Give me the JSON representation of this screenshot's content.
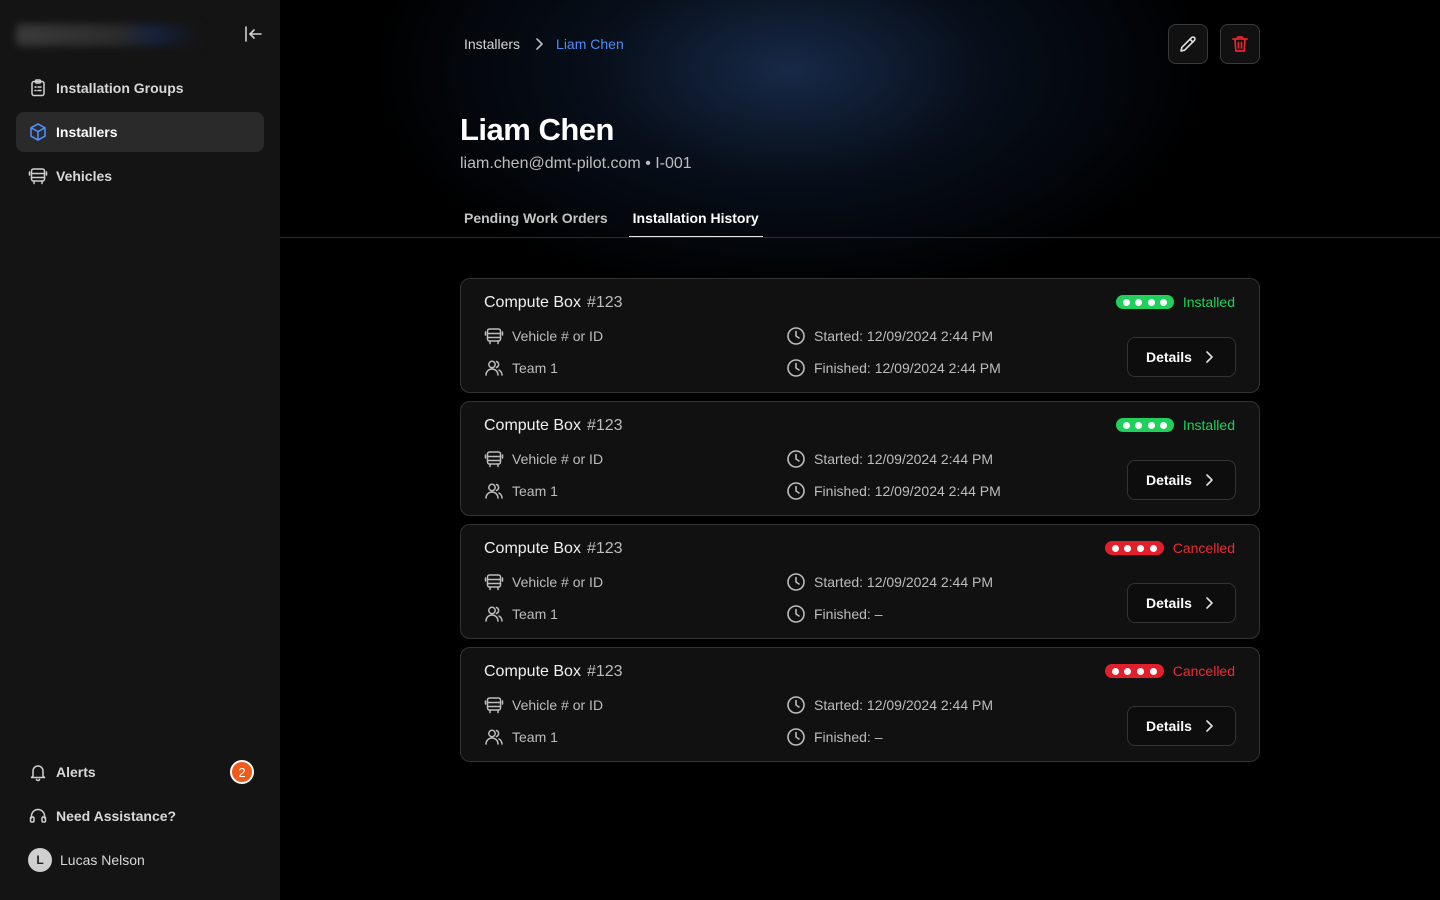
{
  "sidebar": {
    "nav": [
      {
        "label": "Installation Groups",
        "icon": "clipboard-list-icon",
        "active": false
      },
      {
        "label": "Installers",
        "icon": "box-icon",
        "active": true
      },
      {
        "label": "Vehicles",
        "icon": "bus-icon",
        "active": false
      }
    ],
    "alerts": {
      "label": "Alerts",
      "count": "2"
    },
    "help": {
      "label": "Need Assistance?"
    },
    "user": {
      "initial": "L",
      "name": "Lucas Nelson"
    }
  },
  "breadcrumb": {
    "parent": "Installers",
    "current": "Liam Chen"
  },
  "profile": {
    "name": "Liam Chen",
    "meta": "liam.chen@dmt-pilot.com • I-001"
  },
  "tabs": [
    {
      "label": "Pending Work Orders",
      "active": false
    },
    {
      "label": "Installation History",
      "active": true
    }
  ],
  "history": [
    {
      "title": "Compute Box",
      "number": "#123",
      "vehicle": "Vehicle # or ID",
      "team": "Team 1",
      "started": "Started: 12/09/2024 2:44 PM",
      "finished": "Finished: 12/09/2024 2:44 PM",
      "status": "Installed",
      "details": "Details"
    },
    {
      "title": "Compute Box",
      "number": "#123",
      "vehicle": "Vehicle # or ID",
      "team": "Team 1",
      "started": "Started: 12/09/2024 2:44 PM",
      "finished": "Finished: 12/09/2024 2:44 PM",
      "status": "Installed",
      "details": "Details"
    },
    {
      "title": "Compute Box",
      "number": "#123",
      "vehicle": "Vehicle # or ID",
      "team": "Team 1",
      "started": "Started: 12/09/2024 2:44 PM",
      "finished": "Finished: –",
      "status": "Cancelled",
      "details": "Details"
    },
    {
      "title": "Compute Box",
      "number": "#123",
      "vehicle": "Vehicle # or ID",
      "team": "Team 1",
      "started": "Started: 12/09/2024 2:44 PM",
      "finished": "Finished: –",
      "status": "Cancelled",
      "details": "Details"
    }
  ],
  "colors": {
    "accent": "#4f8df7",
    "installed": "#1fd15a",
    "cancelled": "#e21f2a",
    "badge": "#f05a1a"
  }
}
